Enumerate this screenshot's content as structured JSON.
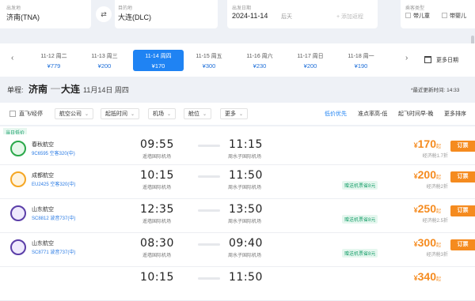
{
  "search": {
    "depart_label": "出发地",
    "depart_value": "济南(TNA)",
    "arrive_label": "目的地",
    "arrive_value": "大连(DLC)",
    "date_label": "出发日期",
    "date_value": "2024-11-14",
    "date_day": "后天",
    "add_return": "+ 添加返程",
    "passenger_label": "乘客类型",
    "child_label": "带儿童",
    "infant_label": "带婴儿"
  },
  "dates": [
    {
      "date": "11-12",
      "day": "周二",
      "price": "¥779"
    },
    {
      "date": "11-13",
      "day": "周三",
      "price": "¥200"
    },
    {
      "date": "11-14",
      "day": "周四",
      "price": "¥170",
      "active": true
    },
    {
      "date": "11-15",
      "day": "周五",
      "price": "¥300"
    },
    {
      "date": "11-16",
      "day": "周六",
      "price": "¥230"
    },
    {
      "date": "11-17",
      "day": "周日",
      "price": "¥200"
    },
    {
      "date": "11-18",
      "day": "周一",
      "price": "¥190"
    }
  ],
  "more_dates": "更多日期",
  "trip": {
    "type": "单程:",
    "from": "济南",
    "to": "大连",
    "date": "11月14日 周四",
    "updated": "*最近更新时间: 14:33"
  },
  "filters": {
    "direct": "直飞/经停",
    "airline": "航空公司",
    "depart_time": "起抵时间",
    "airport": "机场",
    "cabin": "舱位",
    "more": "更多"
  },
  "sorts": {
    "low_price": "低价优先",
    "punctual": "准点率高-低",
    "takeoff": "起飞时间早-晚",
    "more_sort": "更多排序"
  },
  "day_tag": "当日低价",
  "flights": [
    {
      "airline": "春秋航空",
      "flight": "9C6595 空客320(中)",
      "dep": "09:55",
      "dep_airport": "遥墙国际机场",
      "arr": "11:15",
      "arr_airport": "周水子国际机场",
      "tag": "",
      "price": "170",
      "econ": "经济舱1.7折",
      "book": "订票"
    },
    {
      "airline": "成都航空",
      "flight": "EU2425 空客320(中)",
      "dep": "10:15",
      "dep_airport": "遥墙国际机场",
      "arr": "11:50",
      "arr_airport": "周水子国际机场",
      "tag": "赠送机票省8元",
      "price": "200",
      "econ": "经济舱2折",
      "book": "订票"
    },
    {
      "airline": "山东航空",
      "flight": "SC8812 波音737(中)",
      "dep": "12:35",
      "dep_airport": "遥墙国际机场",
      "arr": "13:50",
      "arr_airport": "周水子国际机场",
      "tag": "赠送机票省8元",
      "price": "250",
      "econ": "经济舱2.5折",
      "book": "订票"
    },
    {
      "airline": "山东航空",
      "flight": "SC8771 波音737(中)",
      "dep": "08:30",
      "dep_airport": "遥墙国际机场",
      "arr": "09:40",
      "arr_airport": "周水子国际机场",
      "tag": "赠送机票省8元",
      "price": "300",
      "econ": "经济舱3折",
      "book": "订票"
    },
    {
      "airline": "",
      "flight": "",
      "dep": "10:15",
      "dep_airport": "",
      "arr": "11:50",
      "arr_airport": "",
      "tag": "",
      "price": "340",
      "econ": "",
      "book": ""
    }
  ],
  "price_suffix": "起",
  "colors": {
    "accent": "#1f83f3",
    "price": "#f58b1f",
    "tag": "#19a06b"
  }
}
